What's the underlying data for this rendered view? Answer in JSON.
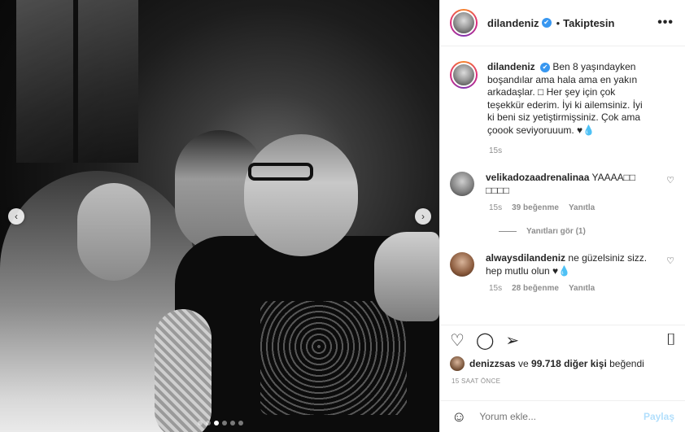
{
  "header": {
    "username": "dilandeniz",
    "verified_symbol": "✔",
    "separator": "•",
    "follow_label": "Takiptesin",
    "more_label": "•••"
  },
  "carousel": {
    "prev_symbol": "‹",
    "next_symbol": "›",
    "slide_count": 6,
    "active_slide": 3
  },
  "caption": {
    "username": "dilandeniz",
    "text": "Ben 8 yaşındayken boşandılar ama hala ama en yakın arkadaşlar. □ Her şey için çok teşekkür ederim. İyi ki ailemsiniz. İyi ki beni siz yetiştirmişsiniz. Çok ama çoook seviyoruuum. ♥💧",
    "time": "15s"
  },
  "comments": [
    {
      "username": "velikadozaadrenalinaa",
      "text": "YAAAA□□ □□□□",
      "time": "15s",
      "likes": "39 beğenme",
      "reply_label": "Yanıtla",
      "view_replies": "Yanıtları gör (1)"
    },
    {
      "username": "alwaysdilandeniz",
      "text": "ne güzelsiniz sizz. hep mutlu olun ♥💧",
      "time": "15s",
      "likes": "28 beğenme",
      "reply_label": "Yanıtla"
    }
  ],
  "icons": {
    "heart": "♡",
    "comment": "◯",
    "share": "➢",
    "bookmark": "⌷",
    "emoji": "☺"
  },
  "likes": {
    "user": "denizzsas",
    "connector": " ve ",
    "count_text": "99.718 diğer kişi",
    "suffix": " beğendi"
  },
  "timestamp": "15 SAAT ÖNCE",
  "add_comment": {
    "placeholder": "Yorum ekle...",
    "post_label": "Paylaş"
  }
}
